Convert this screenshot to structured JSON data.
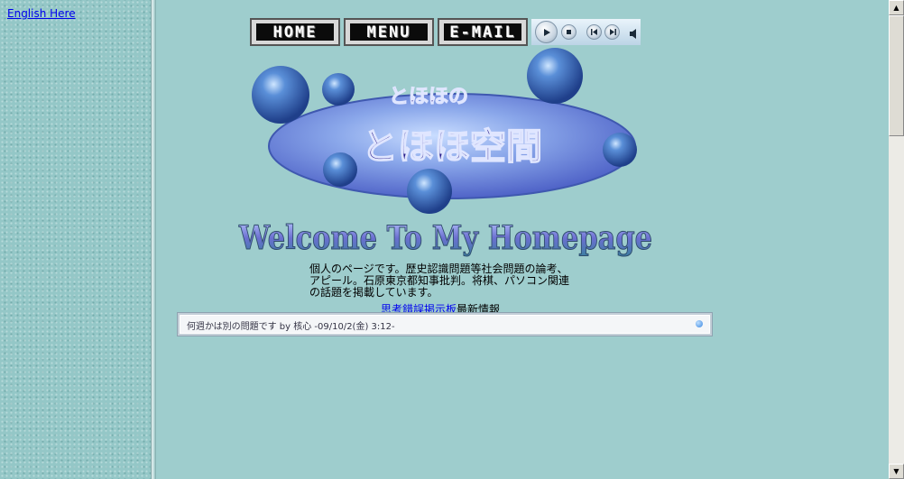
{
  "left_frame": {
    "english_link": "English Here"
  },
  "nav": {
    "home": "HOME",
    "menu": "MENU",
    "email": "E-MAIL"
  },
  "media_player": {
    "icons": [
      "play-icon",
      "stop-icon",
      "previous-icon",
      "next-icon",
      "volume-icon"
    ]
  },
  "logo": {
    "line1": "とほほの",
    "line2": "とほほ空間"
  },
  "welcome": "Welcome To My Homepage",
  "description": {
    "line1": "個人のページです。歴史認識問題等社会問題の論考、",
    "line2": "アピール。石原東京都知事批判。将棋、パソコン関連",
    "line3": "の話題を掲載しています。"
  },
  "latest": {
    "board_link": "思考錯誤掲示板",
    "suffix": "最新情報"
  },
  "ticker": {
    "text": "何週かは別の問題です by 核心 -09/10/2(金) 3:12-"
  },
  "colors": {
    "background": "#9ecdcd",
    "link": "#0000ee",
    "bubble": "#3f7fc4",
    "logo_text": "#2a1e8a"
  }
}
